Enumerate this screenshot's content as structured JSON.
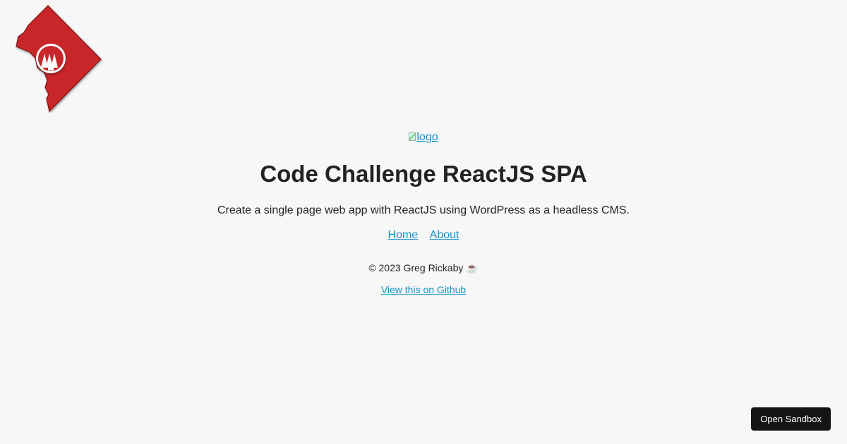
{
  "brand": {
    "accent_color": "#c9262b",
    "icon_name": "dc-map-logo-icon"
  },
  "header": {
    "logo_alt": "logo",
    "title": "Code Challenge ReactJS SPA",
    "tagline": "Create a single page web app with ReactJS using WordPress as a headless CMS."
  },
  "nav": {
    "items": [
      {
        "label": "Home"
      },
      {
        "label": "About"
      }
    ]
  },
  "footer": {
    "copyright": "© 2023 Greg Rickaby ☕",
    "github_label": "View this on Github"
  },
  "sandbox": {
    "button_label": "Open Sandbox"
  },
  "colors": {
    "link": "#1a8fc9",
    "background": "#f7f7f7",
    "button_bg": "#151515"
  }
}
